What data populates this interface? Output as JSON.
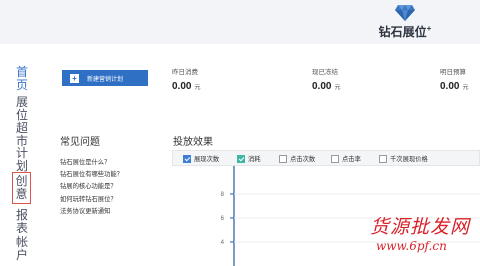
{
  "brand": {
    "title": "钻石展位",
    "plus": "+"
  },
  "nav": {
    "home": "首页",
    "market": "展位超市",
    "plan": "计划",
    "creative": "创意",
    "report": "报表",
    "account": "帐户"
  },
  "toolbar": {
    "create_plan": "新建营销计划"
  },
  "stats": [
    {
      "label": "昨日消费",
      "value": "0.00",
      "unit": "元"
    },
    {
      "label": "现已冻结",
      "value": "0.00",
      "unit": "元"
    },
    {
      "label": "明日预算",
      "value": "0.00",
      "unit": "元"
    }
  ],
  "faq": {
    "title": "常见问题",
    "items": [
      "钻石展位是什么？",
      "钻石展位有哪些功能？",
      "钻展的核心功能是？",
      "如何玩转钻石展位？",
      "法务协议更新通知"
    ]
  },
  "effect": {
    "title": "投放效果",
    "metrics": [
      {
        "label": "展现次数",
        "checked": true,
        "color": "#3c7fd4"
      },
      {
        "label": "消耗",
        "checked": true,
        "color": "#3fb7a3"
      },
      {
        "label": "点击次数",
        "checked": false
      },
      {
        "label": "点击率",
        "checked": false
      },
      {
        "label": "千次展现价格",
        "checked": false
      }
    ],
    "y_ticks": [
      "8",
      "6",
      "4"
    ]
  },
  "colors": {
    "accent": "#2f6fc4",
    "watermark": "#d9232a",
    "diamond": "#3a78c2"
  },
  "watermark": {
    "cn": "货源批发网",
    "url": "www.6pf.cn"
  }
}
